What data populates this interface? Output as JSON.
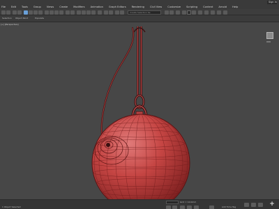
{
  "titlebar": {
    "sign_in": "Sign In"
  },
  "menu": {
    "items": [
      "File",
      "Edit",
      "Tools",
      "Group",
      "Views",
      "Create",
      "Modifiers",
      "Animation",
      "Graph Editors",
      "Rendering",
      "Civil View",
      "Customize",
      "Scripting",
      "Content",
      "Arnold",
      "Help"
    ]
  },
  "toolbar": {
    "selection_set_placeholder": "Create Selection Se"
  },
  "ribbon": {
    "tabs": [
      "Selection",
      "Object Paint",
      "Populate"
    ]
  },
  "viewport": {
    "label": "[+] [Perspective]"
  },
  "status": {
    "left_text": "1 Object Selected",
    "coords": "Grid = 10.0mm",
    "add_time_tag": "Add Time Tag"
  },
  "colors": {
    "model": "#c0403f",
    "viewport_bg": "#474747",
    "ui_bg": "#3b3b3b",
    "accent": "#6aa0d8"
  }
}
